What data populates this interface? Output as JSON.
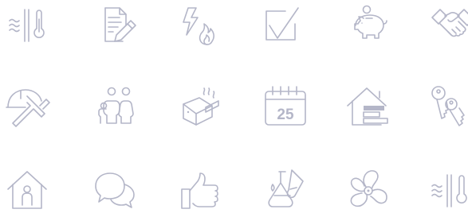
{
  "icon_grid": {
    "stroke_color": "#b4b6c8",
    "background": "#ffffff",
    "rows": [
      [
        "heat-wall-icon",
        "document-edit-icon",
        "power-gas-icon",
        "checkbox-icon",
        "piggy-bank-icon",
        "handshake-icon"
      ],
      [
        "hardhat-hammer-icon",
        "family-icon",
        "boiler-steam-icon",
        "calendar-icon",
        "energy-house-icon",
        "keys-icon"
      ],
      [
        "house-person-icon",
        "speech-bubbles-icon",
        "thumbs-up-icon",
        "lab-flask-icon",
        "fan-icon",
        "heat-wall-icon"
      ]
    ],
    "calendar_day": "25"
  }
}
